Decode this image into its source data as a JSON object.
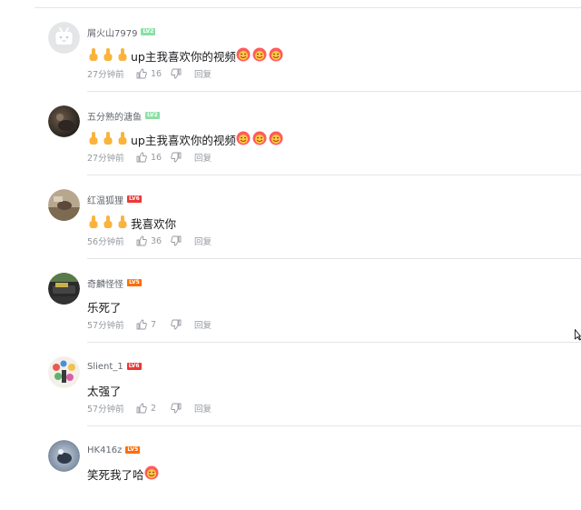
{
  "colors": {
    "username": "#61666d",
    "meta": "#9499a0",
    "divider": "#e3e5e7",
    "thumb": "#fbb33b",
    "level2": "#8be0a4",
    "level5": "#ff6c00",
    "level6": "#ee3636"
  },
  "comments": [
    {
      "username": "屑火山7979",
      "level": "LV2",
      "level_class": "lv2",
      "avatar": "bilibili-tv-avatar",
      "emojis_before": [
        "thumb-icon",
        "thumb-icon",
        "thumb-icon"
      ],
      "text": "up主我喜欢你的视频",
      "emojis_after": [
        "face-icon",
        "face-icon",
        "face-icon"
      ],
      "time": "27分钟前",
      "likes": "16",
      "reply": "回复"
    },
    {
      "username": "五分熟的溏鱼",
      "level": "LV2",
      "level_class": "lv2",
      "avatar": "dark-photo-avatar",
      "emojis_before": [
        "thumb-icon",
        "thumb-icon",
        "thumb-icon"
      ],
      "text": "up主我喜欢你的视频",
      "emojis_after": [
        "face-icon",
        "face-icon",
        "face-icon"
      ],
      "time": "27分钟前",
      "likes": "16",
      "reply": "回复"
    },
    {
      "username": "红温狐狸",
      "level": "LV6",
      "level_class": "lv6",
      "avatar": "fox-photo-avatar",
      "emojis_before": [
        "thumb-icon",
        "thumb-icon",
        "thumb-icon"
      ],
      "text": "我喜欢你",
      "emojis_after": [],
      "time": "56分钟前",
      "likes": "36",
      "reply": "回复"
    },
    {
      "username": "奇麟怪怪",
      "level": "LV5",
      "level_class": "lv5",
      "avatar": "car-photo-avatar",
      "emojis_before": [],
      "text": "乐死了",
      "emojis_after": [],
      "time": "57分钟前",
      "likes": "7",
      "reply": "回复"
    },
    {
      "username": "Slient_1",
      "level": "LV6",
      "level_class": "lv6",
      "avatar": "colorful-art-avatar",
      "emojis_before": [],
      "text": "太强了",
      "emojis_after": [],
      "time": "57分钟前",
      "likes": "2",
      "reply": "回复"
    },
    {
      "username": "HK416z",
      "level": "LV5",
      "level_class": "lv5",
      "avatar": "blue-photo-avatar",
      "emojis_before": [],
      "text": "笑死我了哈",
      "emojis_after": [
        "face-icon"
      ],
      "time": "",
      "likes": "",
      "reply": ""
    }
  ]
}
